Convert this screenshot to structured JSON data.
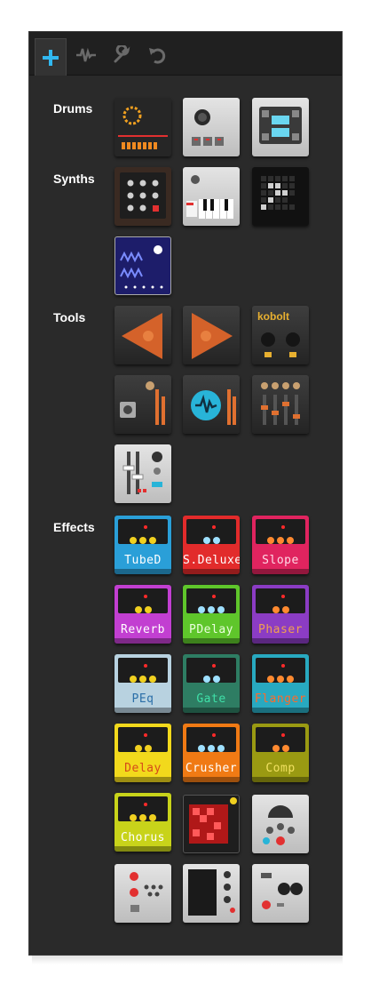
{
  "toolbar": {
    "tabs": [
      {
        "icon": "plus-icon",
        "active": true
      },
      {
        "icon": "waveform-icon",
        "active": false
      },
      {
        "icon": "wrench-icon",
        "active": false
      },
      {
        "icon": "undo-icon",
        "active": false
      }
    ]
  },
  "sections": {
    "drums": "Drums",
    "synths": "Synths",
    "tools": "Tools",
    "effects": "Effects"
  },
  "tools": {
    "kobolt": "kobolt"
  },
  "effects": [
    {
      "name": "TubeD",
      "body": "#2a9fd8",
      "text": "#ffffff"
    },
    {
      "name": "S.Deluxe",
      "body": "#e22b2b",
      "text": "#ffffff"
    },
    {
      "name": "Slope",
      "body": "#e0245f",
      "text": "#ffd9e6"
    },
    {
      "name": "Reverb",
      "body": "#c23fd1",
      "text": "#ffffff"
    },
    {
      "name": "PDelay",
      "body": "#5fc62b",
      "text": "#eaffdd"
    },
    {
      "name": "Phaser",
      "body": "#8b3cc4",
      "text": "#f0a050"
    },
    {
      "name": "PEq",
      "body": "#b8d2e0",
      "text": "#2b6fa8"
    },
    {
      "name": "Gate",
      "body": "#2e7d63",
      "text": "#3fe0a8"
    },
    {
      "name": "Flanger",
      "body": "#28a9c0",
      "text": "#ff6a2a"
    },
    {
      "name": "Delay",
      "body": "#f2d91c",
      "text": "#d64a1a"
    },
    {
      "name": "Crusher",
      "body": "#f07a14",
      "text": "#ffffff"
    },
    {
      "name": "Comp",
      "body": "#9a9a12",
      "text": "#f0e060"
    },
    {
      "name": "Chorus",
      "body": "#c8d31a",
      "text": "#ffffff"
    }
  ]
}
